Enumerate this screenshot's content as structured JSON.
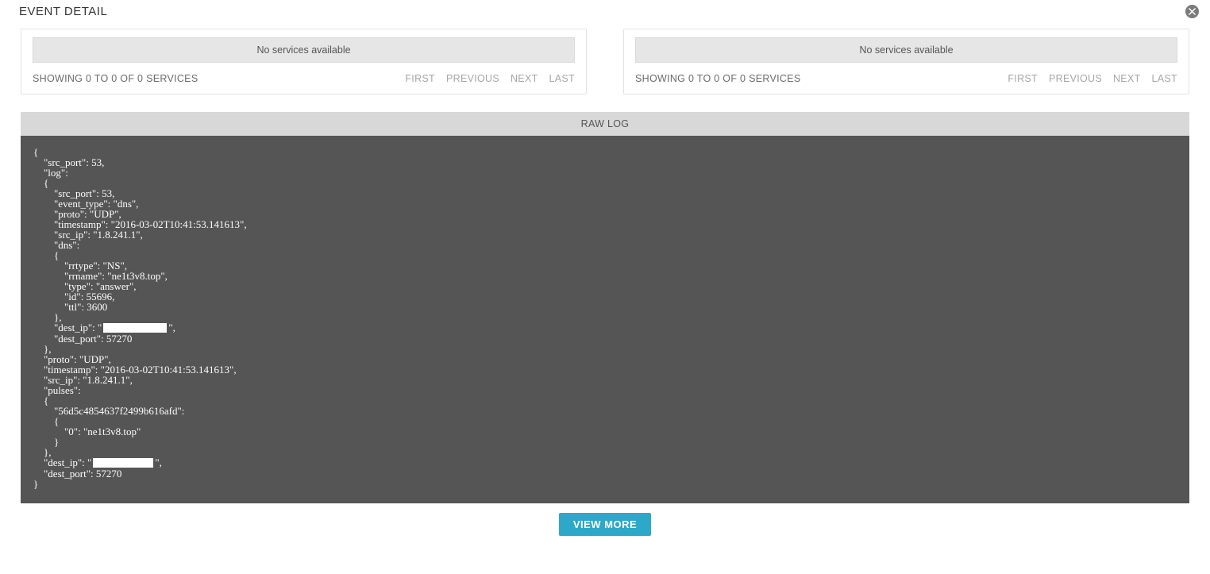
{
  "header": {
    "title": "EVENT DETAIL"
  },
  "panels": {
    "left": {
      "message": "No services available",
      "summary": "SHOWING 0 TO 0 OF 0 SERVICES",
      "pager": {
        "first": "FIRST",
        "previous": "PREVIOUS",
        "next": "NEXT",
        "last": "LAST"
      }
    },
    "right": {
      "message": "No services available",
      "summary": "SHOWING 0 TO 0 OF 0 SERVICES",
      "pager": {
        "first": "FIRST",
        "previous": "PREVIOUS",
        "next": "NEXT",
        "last": "LAST"
      }
    }
  },
  "rawlog": {
    "heading": "RAW LOG",
    "segments": {
      "a": "{\n    \"src_port\": 53,\n    \"log\":\n    {\n        \"src_port\": 53,\n        \"event_type\": \"dns\",\n        \"proto\": \"UDP\",\n        \"timestamp\": \"2016-03-02T10:41:53.141613\",\n        \"src_ip\": \"1.8.241.1\",\n        \"dns\":\n        {\n            \"rrtype\": \"NS\",\n            \"rrname\": \"ne1t3v8.top\",\n            \"type\": \"answer\",\n            \"id\": 55696,\n            \"ttl\": 3600\n        },\n        \"dest_ip\": \"",
      "b": "\",\n        \"dest_port\": 57270\n    },\n    \"proto\": \"UDP\",\n    \"timestamp\": \"2016-03-02T10:41:53.141613\",\n    \"src_ip\": \"1.8.241.1\",\n    \"pulses\":\n    {\n        \"56d5c4854637f2499b616afd\":\n        {\n            \"0\": \"ne1t3v8.top\"\n        }\n    },\n    \"dest_ip\": \"",
      "c": "\",\n    \"dest_port\": 57270\n}"
    }
  },
  "actions": {
    "view_more": "VIEW MORE"
  }
}
